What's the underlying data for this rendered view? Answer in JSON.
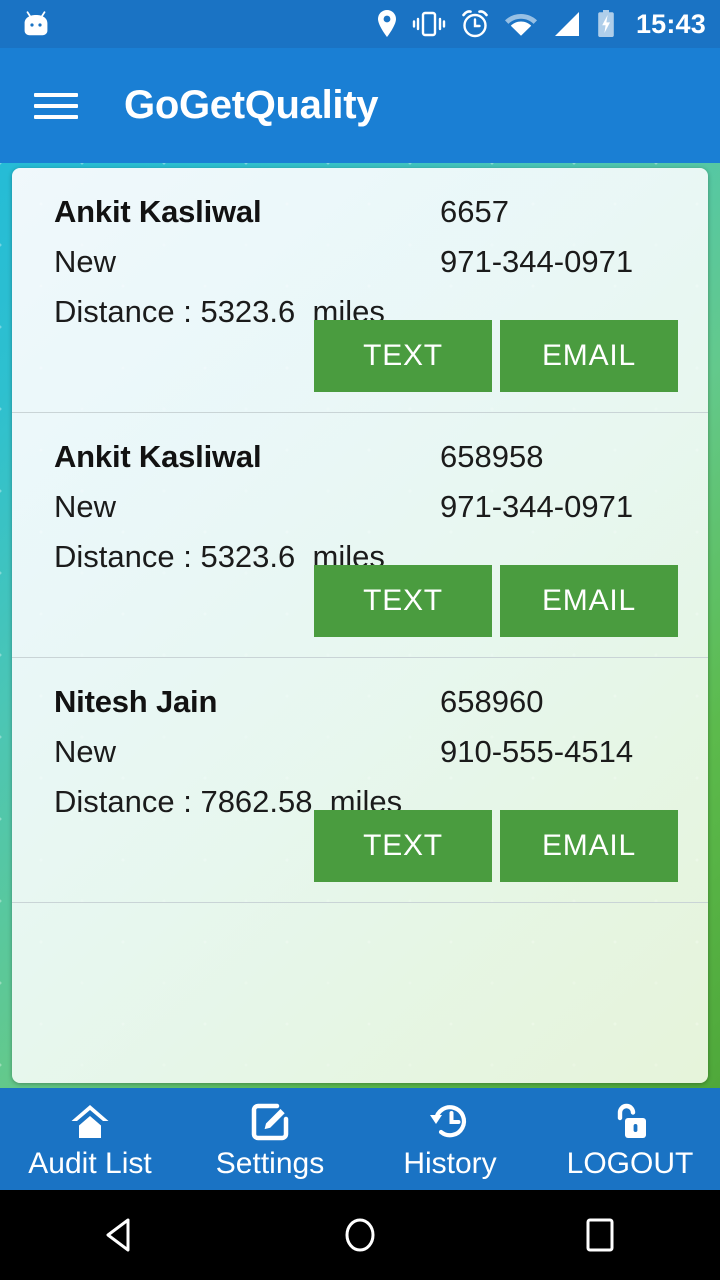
{
  "statusbar": {
    "time": "15:43",
    "icons": [
      "android-head-icon",
      "location-pin-icon",
      "vibrate-icon",
      "alarm-clock-icon",
      "wifi-icon",
      "signal-icon",
      "battery-charging-icon"
    ]
  },
  "appbar": {
    "title": "GoGetQuality",
    "menu_icon": "hamburger-menu-icon"
  },
  "list": {
    "rows": [
      {
        "name": "Ankit Kasliwal",
        "status": "New",
        "distance": "Distance : 5323.6  miles",
        "id": "6657",
        "phone": "971-344-0971",
        "text_label": "TEXT",
        "email_label": "EMAIL"
      },
      {
        "name": "Ankit Kasliwal",
        "status": "New",
        "distance": "Distance : 5323.6  miles",
        "id": "658958",
        "phone": "971-344-0971",
        "text_label": "TEXT",
        "email_label": "EMAIL"
      },
      {
        "name": "Nitesh Jain",
        "status": "New",
        "distance": "Distance : 7862.58  miles",
        "id": "658960",
        "phone": "910-555-4514",
        "text_label": "TEXT",
        "email_label": "EMAIL"
      }
    ]
  },
  "bottomnav": {
    "items": [
      {
        "label": "Audit List",
        "icon": "home-icon"
      },
      {
        "label": "Settings",
        "icon": "edit-square-icon"
      },
      {
        "label": "History",
        "icon": "history-clock-icon"
      },
      {
        "label": "LOGOUT",
        "icon": "unlock-padlock-icon"
      }
    ]
  },
  "androidnav": {
    "back": "back-triangle-icon",
    "home": "home-circle-icon",
    "recents": "recents-square-icon"
  },
  "colors": {
    "status_bar": "#1a73c4",
    "app_bar": "#1a7fd4",
    "button_green": "#4a9c3f",
    "nav_bar": "#1a73c4"
  }
}
